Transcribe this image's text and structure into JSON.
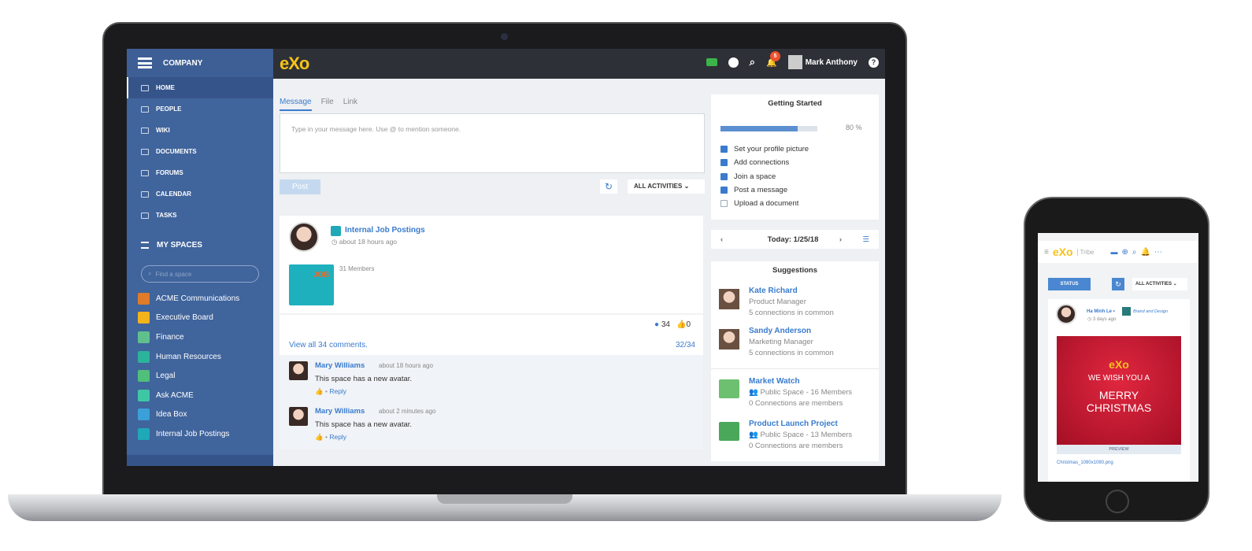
{
  "sidebar": {
    "title": "COMPANY",
    "nav": [
      {
        "label": "HOME",
        "icon": "home-icon"
      },
      {
        "label": "PEOPLE",
        "icon": "people-icon"
      },
      {
        "label": "WIKI",
        "icon": "wiki-icon"
      },
      {
        "label": "DOCUMENTS",
        "icon": "documents-icon"
      },
      {
        "label": "FORUMS",
        "icon": "forums-icon"
      },
      {
        "label": "CALENDAR",
        "icon": "calendar-icon"
      },
      {
        "label": "TASKS",
        "icon": "tasks-icon"
      }
    ],
    "my_spaces": "MY SPACES",
    "find_placeholder": "Find a space",
    "spaces": [
      {
        "label": "ACME Communications",
        "color": "#e07b2a"
      },
      {
        "label": "Executive Board",
        "color": "#f2b31b"
      },
      {
        "label": "Finance",
        "color": "#5fc08d"
      },
      {
        "label": "Human Resources",
        "color": "#2bb39b"
      },
      {
        "label": "Legal",
        "color": "#4fbf7a"
      },
      {
        "label": "Ask ACME",
        "color": "#3fc6a5"
      },
      {
        "label": "Idea Box",
        "color": "#3b9fd8"
      },
      {
        "label": "Internal Job Postings",
        "color": "#1fa9b8"
      }
    ]
  },
  "topbar": {
    "logo": "eXo",
    "user": "Mark Anthony",
    "notifications": "5",
    "help": "?"
  },
  "composer": {
    "tabs": [
      "Message",
      "File",
      "Link"
    ],
    "placeholder": "Type in your message here. Use @ to mention someone.",
    "post": "Post",
    "filter": "ALL ACTIVITIES"
  },
  "activity": {
    "space": "Internal Job Postings",
    "time": "about 18 hours ago",
    "members": "31 Members",
    "image_text": "JOB",
    "comments_count": "34",
    "likes": "0",
    "view_all": "View all 34 comments.",
    "pager": "32/34",
    "comments": [
      {
        "author": "Mary Williams",
        "time": "about 18 hours ago",
        "text": "This space has a new avatar.",
        "reply": "Reply"
      },
      {
        "author": "Mary Williams",
        "time": "about 2 minutes ago",
        "text": "This space has a new avatar.",
        "reply": "Reply"
      }
    ]
  },
  "getting_started": {
    "title": "Getting Started",
    "progress_percent": 80,
    "progress_label": "80 %",
    "tasks": [
      {
        "label": "Set your profile picture",
        "done": true
      },
      {
        "label": "Add connections",
        "done": true
      },
      {
        "label": "Join a space",
        "done": true
      },
      {
        "label": "Post a message",
        "done": true
      },
      {
        "label": "Upload a document",
        "done": false
      }
    ]
  },
  "calendar": {
    "date": "Today: 1/25/18",
    "prev": "‹",
    "next": "›"
  },
  "suggestions": {
    "title": "Suggestions",
    "people": [
      {
        "name": "Kate Richard",
        "role": "Product Manager",
        "common": "5 connections in common"
      },
      {
        "name": "Sandy Anderson",
        "role": "Marketing Manager",
        "common": "5 connections in common"
      }
    ],
    "spaces": [
      {
        "name": "Market Watch",
        "type": "Public Space - 16 Members",
        "conn": "0 Connections are members",
        "color": "#6cc070"
      },
      {
        "name": "Product Launch Project",
        "type": "Public Space - 13 Members",
        "conn": "0 Connections are members",
        "color": "#4aa85a"
      }
    ]
  },
  "phone": {
    "logo": "eXo",
    "brand": "Tribe",
    "status": "STATUS",
    "filter": "ALL ACTIVITIES",
    "author": "Ha Minh Le",
    "space": "Brand and Design",
    "time": "3 days ago",
    "card_logo": "eXo",
    "card_line1": "WE WISH YOU A",
    "card_line2": "MERRY",
    "card_line3": "CHRISTMAS",
    "preview": "PREVIEW",
    "file": "Christmas_1080x1080.png"
  }
}
